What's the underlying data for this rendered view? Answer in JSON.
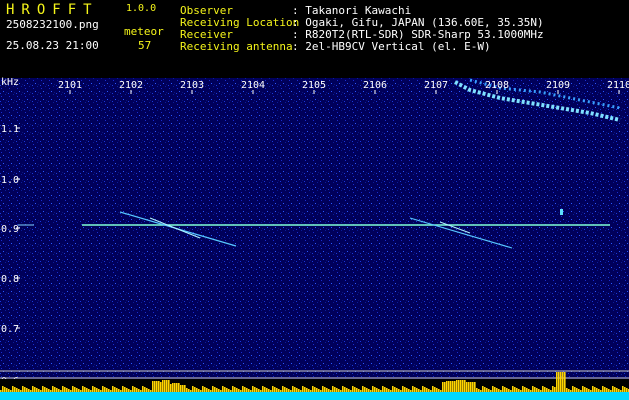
{
  "app": {
    "logo": "HROFFT",
    "version": "1.0.0",
    "filename": "2508232100.png",
    "datetime": "25.08.23 21:00",
    "meteor_label": "meteor",
    "meteor_count": "57"
  },
  "station": {
    "rows": [
      {
        "key": "Observer",
        "value": ": Takanori Kawachi"
      },
      {
        "key": "Receiving Location",
        "value": ": Ogaki, Gifu, JAPAN (136.60E, 35.35N)"
      },
      {
        "key": "Receiver",
        "value": ": R820T2(RTL-SDR) SDR-Sharp 53.1000MHz"
      },
      {
        "key": "Receiving antenna",
        "value": ": 2el-HB9CV Vertical (el. E-W)"
      }
    ]
  },
  "axis": {
    "unit": "kHz",
    "x_ticks": [
      "2101",
      "2102",
      "2103",
      "2104",
      "2105",
      "2106",
      "2107",
      "2108",
      "2109",
      "2110"
    ],
    "y_ticks": [
      "1.1",
      "1.0",
      "0.9",
      "0.8",
      "0.7",
      "0.6"
    ]
  },
  "colors": {
    "background": "#00005a",
    "carrier": "#7fffd4",
    "text_header": "#f5f51a",
    "activity": "#ffd400",
    "activity_base": "#00d8ff"
  }
}
